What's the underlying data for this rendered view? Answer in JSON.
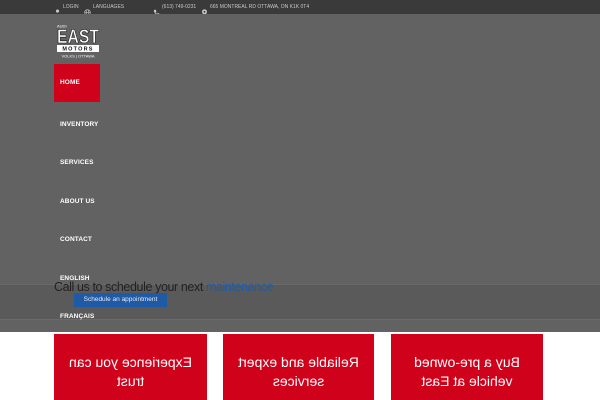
{
  "topbar": {
    "login": "LOGIN",
    "languages": "LANGUAGES",
    "phone": "(613) 749-0231",
    "address": "665 MONTREAL RD OTTAWA, ON K1K 0T4",
    "icons": [
      "user-icon",
      "globe-icon",
      "phone-icon",
      "map-pin-icon"
    ]
  },
  "logo": {
    "top_text": "AUDI",
    "main_text": "EAST",
    "band_text": "MOTORS",
    "bottom_text": "VOLKS | OTTAWA"
  },
  "nav": {
    "items": [
      "HOME",
      "INVENTORY",
      "SERVICES",
      "ABOUT US",
      "CONTACT",
      "ENGLISH",
      "FRANÇAIS"
    ],
    "active_index": 0
  },
  "schedule": {
    "text": "Call us to schedule your next",
    "highlight": "maintenance",
    "button": "Schedule an appointment"
  },
  "cards": [
    {
      "label": "Experience you can trust"
    },
    {
      "label": "Reliable and expert services"
    },
    {
      "label": "Buy a pre-owned vehicle at East"
    }
  ],
  "colors": {
    "accent_red": "#d0021b",
    "accent_blue": "#1f5aa6",
    "topbar_bg": "#3a3a3a",
    "hero_bg": "#626262"
  }
}
